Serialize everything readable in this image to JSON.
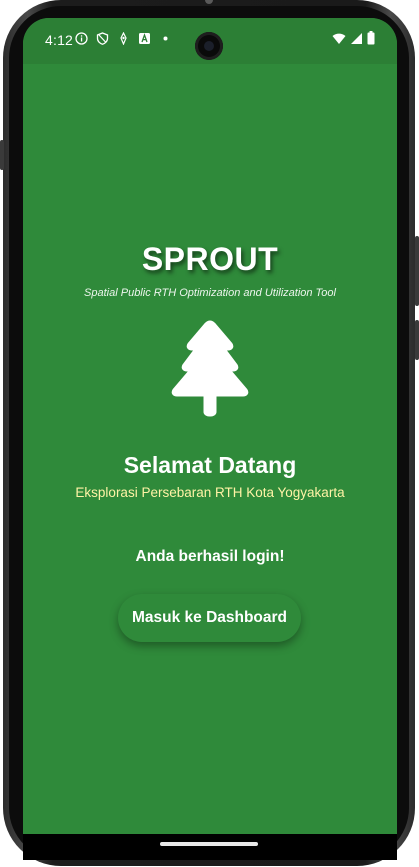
{
  "status_bar": {
    "time": "4:12",
    "left_icons": [
      "info-icon",
      "shield-icon",
      "hand-icon",
      "a-letter-icon",
      "dot-icon"
    ],
    "right_icons": [
      "wifi-icon",
      "signal-icon",
      "battery-icon"
    ]
  },
  "app": {
    "title": "SPROUT",
    "subtitle": "Spatial Public RTH Optimization and Utilization Tool",
    "logo_icon": "tree-icon"
  },
  "welcome": {
    "heading": "Selamat Datang",
    "tagline": "Eksplorasi Persebaran RTH Kota Yogyakarta"
  },
  "login": {
    "message": "Anda berhasil login!",
    "dashboard_button": "Masuk ke Dashboard"
  },
  "colors": {
    "background": "#2f8a3a",
    "status_bar": "#2c7f35",
    "tagline": "#fff3a6",
    "text": "#ffffff"
  }
}
